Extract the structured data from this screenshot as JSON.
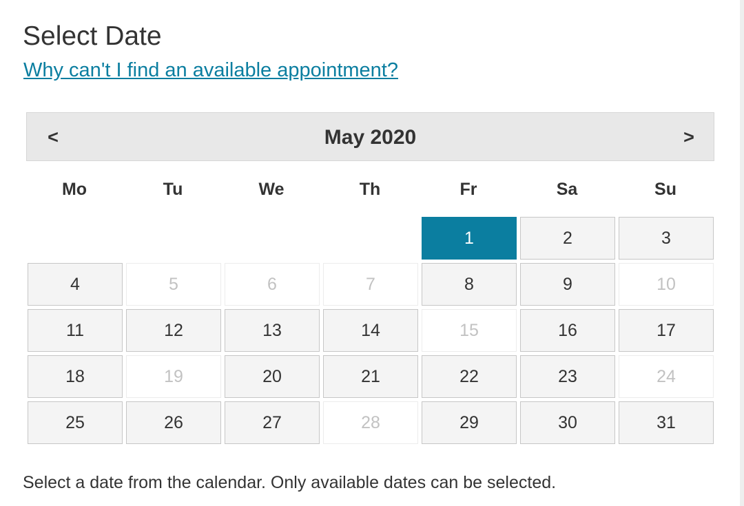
{
  "title": "Select Date",
  "help_link": "Why can't I find an available appointment?",
  "calendar": {
    "month_label": "May 2020",
    "prev_label": "<",
    "next_label": ">",
    "weekdays": [
      "Mo",
      "Tu",
      "We",
      "Th",
      "Fr",
      "Sa",
      "Su"
    ],
    "selected_day": "1",
    "weeks": [
      [
        null,
        null,
        null,
        null,
        {
          "day": "1",
          "available": true,
          "selected": true
        },
        {
          "day": "2",
          "available": true
        },
        {
          "day": "3",
          "available": true
        }
      ],
      [
        {
          "day": "4",
          "available": true
        },
        {
          "day": "5",
          "available": false
        },
        {
          "day": "6",
          "available": false
        },
        {
          "day": "7",
          "available": false
        },
        {
          "day": "8",
          "available": true
        },
        {
          "day": "9",
          "available": true
        },
        {
          "day": "10",
          "available": false
        }
      ],
      [
        {
          "day": "11",
          "available": true
        },
        {
          "day": "12",
          "available": true
        },
        {
          "day": "13",
          "available": true
        },
        {
          "day": "14",
          "available": true
        },
        {
          "day": "15",
          "available": false
        },
        {
          "day": "16",
          "available": true
        },
        {
          "day": "17",
          "available": true
        }
      ],
      [
        {
          "day": "18",
          "available": true
        },
        {
          "day": "19",
          "available": false
        },
        {
          "day": "20",
          "available": true
        },
        {
          "day": "21",
          "available": true
        },
        {
          "day": "22",
          "available": true
        },
        {
          "day": "23",
          "available": true
        },
        {
          "day": "24",
          "available": false
        }
      ],
      [
        {
          "day": "25",
          "available": true
        },
        {
          "day": "26",
          "available": true
        },
        {
          "day": "27",
          "available": true
        },
        {
          "day": "28",
          "available": false
        },
        {
          "day": "29",
          "available": true
        },
        {
          "day": "30",
          "available": true
        },
        {
          "day": "31",
          "available": true
        }
      ]
    ]
  },
  "instruction": "Select a date from the calendar. Only available dates can be selected.",
  "colors": {
    "accent": "#0b7ea0",
    "text": "#333333",
    "header_bg": "#e8e8e8",
    "available_bg": "#f4f4f4",
    "unavailable_text": "#c2c2c2"
  }
}
